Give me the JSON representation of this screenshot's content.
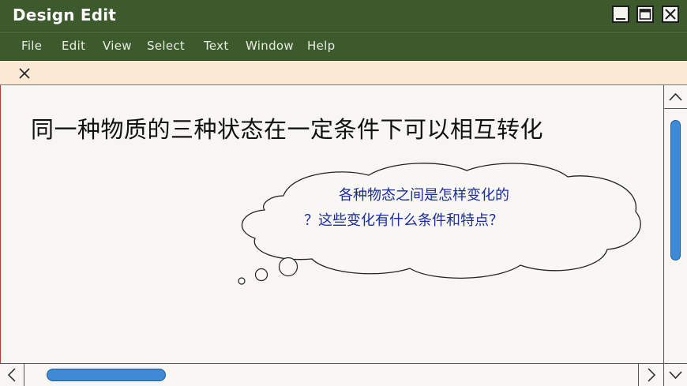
{
  "window": {
    "title": "Design Edit",
    "controls": [
      "minimize-icon",
      "maximize-icon",
      "close-icon"
    ]
  },
  "menu": {
    "items": [
      "File",
      "Edit",
      "View",
      "Select",
      "Text",
      "Window",
      "Help"
    ]
  },
  "tab": {
    "close_icon": "close-icon"
  },
  "slide": {
    "heading": "同一种物质的三种状态在一定条件下可以相互转化",
    "thought_bubble": {
      "line1": "各种物态之间是怎样变化的",
      "line2": "？这些变化有什么条件和特点？"
    }
  },
  "scrollbars": {
    "vertical": {
      "up_icon": "chevron-up-icon",
      "down_icon": "chevron-down-icon"
    },
    "horizontal": {
      "left_icon": "chevron-left-icon",
      "right_icon": "chevron-right-icon"
    }
  },
  "colors": {
    "titlebar": "#3c5a2b",
    "tabstrip": "#fbe9d3",
    "canvas": "#f7f6f2",
    "scroll_thumb": "#3e8ad6",
    "bubble_text": "#1c2c9e"
  }
}
